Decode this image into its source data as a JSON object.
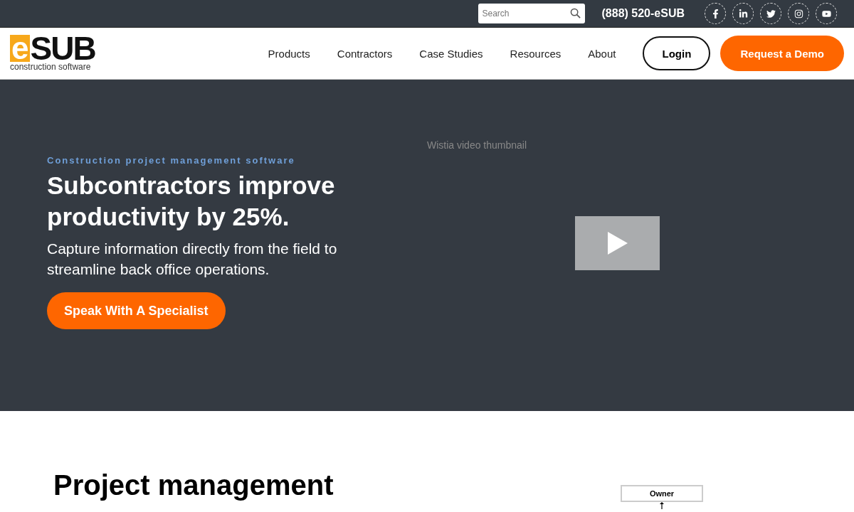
{
  "top_bar": {
    "search": {
      "placeholder": "Search"
    },
    "phone": "(888) 520-eSUB"
  },
  "logo": {
    "mark": "e",
    "name": "SUB",
    "tagline": "construction software"
  },
  "nav": {
    "items": [
      "Products",
      "Contractors",
      "Case Studies",
      "Resources",
      "About"
    ],
    "login": "Login",
    "cta": "Request a Demo"
  },
  "hero": {
    "eyebrow": "Construction project management software",
    "title": "Subcontractors improve productivity by 25%.",
    "subtitle": "Capture information directly from the field to streamline back office operations.",
    "button": "Speak With A Specialist",
    "video": {
      "alt": "Wistia video thumbnail"
    }
  },
  "section": {
    "title": "Project management",
    "diagram": {
      "top_node": "Owner"
    }
  }
}
